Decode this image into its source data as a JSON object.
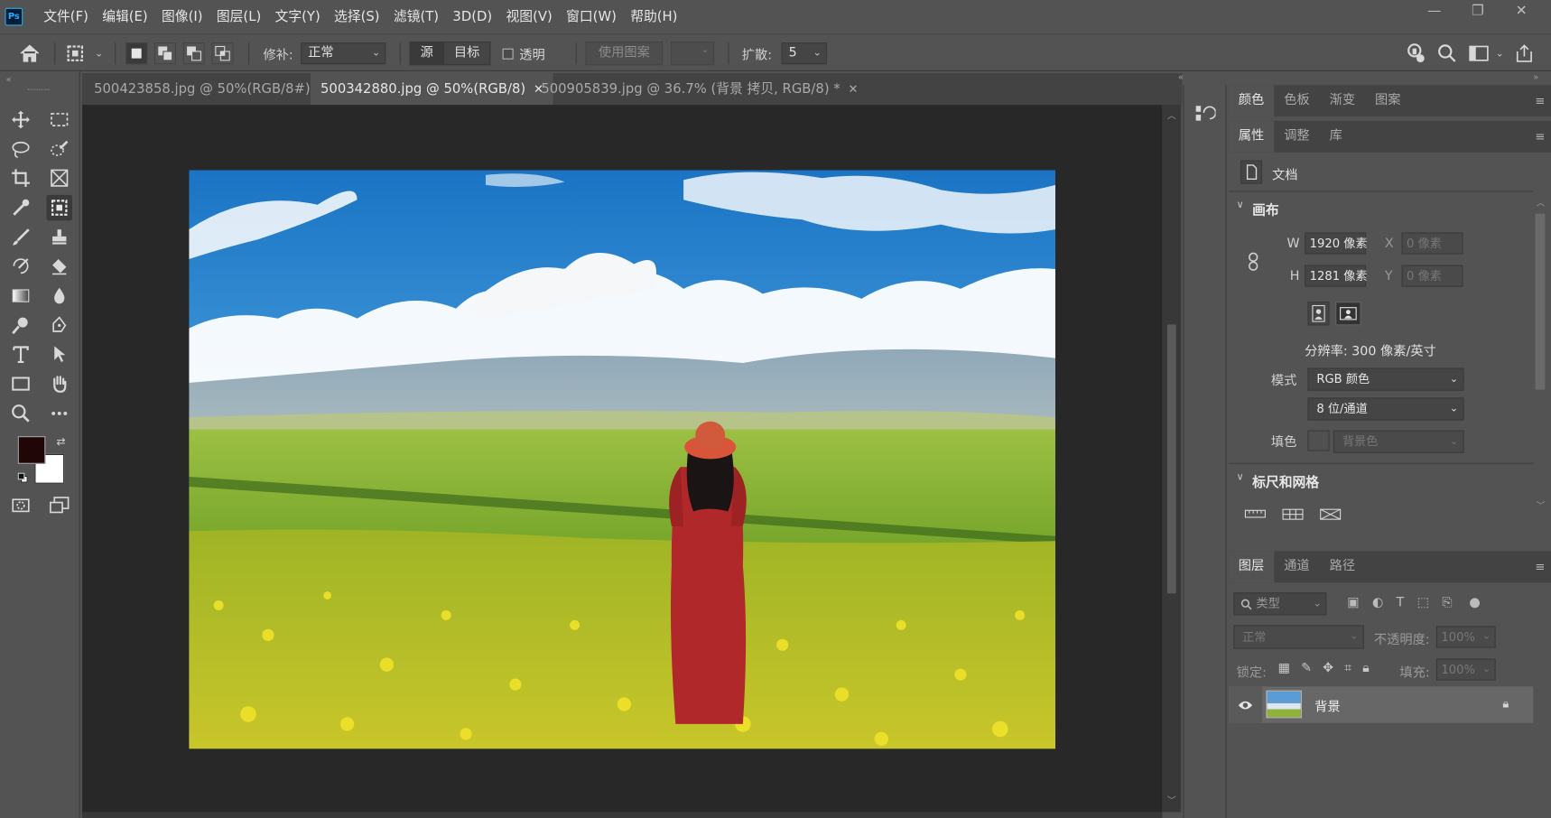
{
  "app": {
    "logo": "Ps"
  },
  "menu": [
    "文件(F)",
    "编辑(E)",
    "图像(I)",
    "图层(L)",
    "文字(Y)",
    "选择(S)",
    "滤镜(T)",
    "3D(D)",
    "视图(V)",
    "窗口(W)",
    "帮助(H)"
  ],
  "window_controls": {
    "minimize": "—",
    "maximize": "❐",
    "close": "✕"
  },
  "options": {
    "repair_label": "修补:",
    "repair_value": "正常",
    "source_label": "源",
    "target_label": "目标",
    "transparent_label": "透明",
    "use_pattern_label": "使用图案",
    "diffusion_label": "扩散:",
    "diffusion_value": "5"
  },
  "tabs": [
    {
      "label": "500423858.jpg @ 50%(RGB/8#)",
      "close": "✕"
    },
    {
      "label": "500342880.jpg @ 50%(RGB/8)",
      "close": "✕"
    },
    {
      "label": "500905839.jpg @ 36.7% (背景 拷贝, RGB/8) *",
      "close": "✕"
    }
  ],
  "colors": {
    "foreground": "#200607",
    "background": "#ffffff",
    "accent": "#31a8ff"
  },
  "color_panel": {
    "tabs": [
      "颜色",
      "色板",
      "渐变",
      "图案"
    ]
  },
  "props_panel": {
    "tabs": [
      "属性",
      "调整",
      "库"
    ],
    "doc_label": "文档",
    "canvas_title": "画布",
    "w_label": "W",
    "w_value": "1920 像素",
    "h_label": "H",
    "h_value": "1281 像素",
    "x_label": "X",
    "x_placeholder": "0 像素",
    "y_label": "Y",
    "y_placeholder": "0 像素",
    "resolution": "分辨率: 300 像素/英寸",
    "mode_label": "模式",
    "mode_value": "RGB 颜色",
    "depth_value": "8 位/通道",
    "fill_label": "填色",
    "fill_value": "背景色",
    "rulers_title": "标尺和网格"
  },
  "layers_panel": {
    "tabs": [
      "图层",
      "通道",
      "路径"
    ],
    "filter_placeholder": "类型",
    "blend_mode": "正常",
    "opacity_label": "不透明度:",
    "opacity_value": "100%",
    "lock_label": "锁定:",
    "fill_label": "填充:",
    "fill_value": "100%",
    "layer_name": "背景"
  }
}
